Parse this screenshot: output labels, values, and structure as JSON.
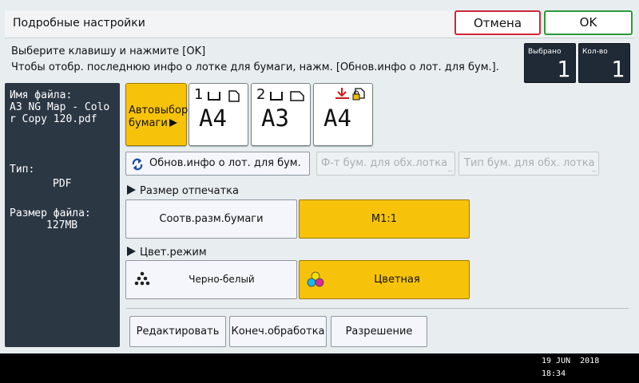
{
  "header": {
    "title": "Подробные настройки",
    "cancel_label": "Отмена",
    "ok_label": "OK"
  },
  "instructions": {
    "line1": "Выберите клавишу и нажмите [OK]",
    "line2": "Чтобы отобр. последнюю инфо о лотке для бумаги, нажм. [Обнов.инфо о лот. для бум.]."
  },
  "counters": {
    "selected_label": "Выбрано",
    "selected_value": "1",
    "quantity_label": "Кол-во",
    "quantity_value": "1"
  },
  "file_info": {
    "name_label": "Имя файла:",
    "name_lines": [
      "A3 NG Map - Colo",
      "r Copy 120.pdf"
    ],
    "type_label": "Тип:",
    "type_value": "PDF",
    "size_label": "Размер файла:",
    "size_value": "127MB"
  },
  "paper": {
    "auto_line1": "Автовыбор",
    "auto_line2": "бумаги",
    "trays": [
      {
        "number": "1",
        "size": "A4"
      },
      {
        "number": "2",
        "size": "A3"
      },
      {
        "number": "",
        "size": "A4"
      }
    ],
    "update_label": "Обнов.инфо о лот. для бум.",
    "bypass_format_label": "Ф-т бум. для обх.лотка",
    "bypass_type_label": "Тип бум. для обх. лотка"
  },
  "print_size": {
    "section_label": "Размер отпечатка",
    "fit_label": "Соотв.разм.бумаги",
    "scale_label": "M1:1",
    "selected": "M1:1"
  },
  "color_mode": {
    "section_label": "Цвет.режим",
    "bw_label": "Черно-белый",
    "color_label": "Цветная",
    "selected": "Цветная"
  },
  "actions": {
    "edit_label": "Редактировать",
    "finishing_label": "Конеч.обработка",
    "resolution_label": "Разрешение"
  },
  "status": {
    "date": "19 JUN  2018",
    "time": "18:34"
  },
  "colors": {
    "selected_yellow": "#f7c30a",
    "cancel_red": "#d02838",
    "ok_green": "#2a9a3a",
    "panel_dark": "#2c3744"
  }
}
